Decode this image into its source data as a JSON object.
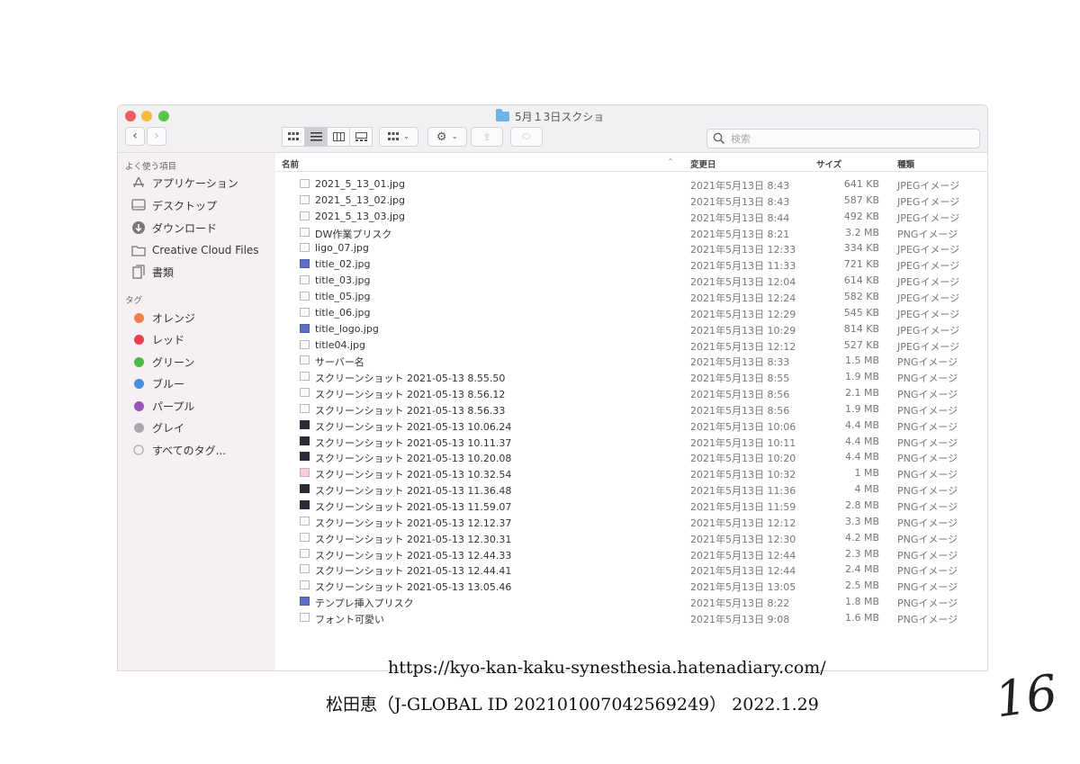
{
  "window": {
    "title": "5月１3日スクショ",
    "search_placeholder": "検索"
  },
  "sidebar": {
    "favorites_heading": "よく使う項目",
    "favorites": [
      {
        "label": "アプリケーション",
        "icon": "applications-icon"
      },
      {
        "label": "デスクトップ",
        "icon": "desktop-icon"
      },
      {
        "label": "ダウンロード",
        "icon": "download-icon"
      },
      {
        "label": "Creative Cloud Files",
        "icon": "folder-icon"
      },
      {
        "label": "書類",
        "icon": "documents-icon"
      }
    ],
    "tags_heading": "タグ",
    "tags": [
      {
        "label": "オレンジ",
        "color": "#f07f4e"
      },
      {
        "label": "レッド",
        "color": "#e8404f"
      },
      {
        "label": "グリーン",
        "color": "#4cb848"
      },
      {
        "label": "ブルー",
        "color": "#4a8ee0"
      },
      {
        "label": "パープル",
        "color": "#9a55b4"
      },
      {
        "label": "グレイ",
        "color": "#a8a8b0"
      }
    ],
    "all_tags": "すべてのタグ..."
  },
  "columns": {
    "name": "名前",
    "modified": "変更日",
    "size": "サイズ",
    "kind": "種類"
  },
  "files": [
    {
      "name": "2021_5_13_01.jpg",
      "date": "2021年5月13日 8:43",
      "size": "641 KB",
      "kind": "JPEGイメージ",
      "icon": "image"
    },
    {
      "name": "2021_5_13_02.jpg",
      "date": "2021年5月13日 8:43",
      "size": "587 KB",
      "kind": "JPEGイメージ",
      "icon": "image"
    },
    {
      "name": "2021_5_13_03.jpg",
      "date": "2021年5月13日 8:44",
      "size": "492 KB",
      "kind": "JPEGイメージ",
      "icon": "image"
    },
    {
      "name": "DW作業プリスク",
      "date": "2021年5月13日 8:21",
      "size": "3.2 MB",
      "kind": "PNGイメージ",
      "icon": "image"
    },
    {
      "name": "ligo_07.jpg",
      "date": "2021年5月13日 12:33",
      "size": "334 KB",
      "kind": "JPEGイメージ",
      "icon": "image"
    },
    {
      "name": "title_02.jpg",
      "date": "2021年5月13日 11:33",
      "size": "721 KB",
      "kind": "JPEGイメージ",
      "icon": "blue"
    },
    {
      "name": "title_03.jpg",
      "date": "2021年5月13日 12:04",
      "size": "614 KB",
      "kind": "JPEGイメージ",
      "icon": "image"
    },
    {
      "name": "title_05.jpg",
      "date": "2021年5月13日 12:24",
      "size": "582 KB",
      "kind": "JPEGイメージ",
      "icon": "image"
    },
    {
      "name": "title_06.jpg",
      "date": "2021年5月13日 12:29",
      "size": "545 KB",
      "kind": "JPEGイメージ",
      "icon": "image"
    },
    {
      "name": "title_logo.jpg",
      "date": "2021年5月13日 10:29",
      "size": "814 KB",
      "kind": "JPEGイメージ",
      "icon": "blue"
    },
    {
      "name": "title04.jpg",
      "date": "2021年5月13日 12:12",
      "size": "527 KB",
      "kind": "JPEGイメージ",
      "icon": "image"
    },
    {
      "name": "サーバー名",
      "date": "2021年5月13日 8:33",
      "size": "1.5 MB",
      "kind": "PNGイメージ",
      "icon": "image"
    },
    {
      "name": "スクリーンショット 2021-05-13 8.55.50",
      "date": "2021年5月13日 8:55",
      "size": "1.9 MB",
      "kind": "PNGイメージ",
      "icon": "image"
    },
    {
      "name": "スクリーンショット 2021-05-13 8.56.12",
      "date": "2021年5月13日 8:56",
      "size": "2.1 MB",
      "kind": "PNGイメージ",
      "icon": "image"
    },
    {
      "name": "スクリーンショット 2021-05-13 8.56.33",
      "date": "2021年5月13日 8:56",
      "size": "1.9 MB",
      "kind": "PNGイメージ",
      "icon": "image"
    },
    {
      "name": "スクリーンショット 2021-05-13 10.06.24",
      "date": "2021年5月13日 10:06",
      "size": "4.4 MB",
      "kind": "PNGイメージ",
      "icon": "dark"
    },
    {
      "name": "スクリーンショット 2021-05-13 10.11.37",
      "date": "2021年5月13日 10:11",
      "size": "4.4 MB",
      "kind": "PNGイメージ",
      "icon": "dark"
    },
    {
      "name": "スクリーンショット 2021-05-13 10.20.08",
      "date": "2021年5月13日 10:20",
      "size": "4.4 MB",
      "kind": "PNGイメージ",
      "icon": "dark"
    },
    {
      "name": "スクリーンショット 2021-05-13 10.32.54",
      "date": "2021年5月13日 10:32",
      "size": "1 MB",
      "kind": "PNGイメージ",
      "icon": "pink"
    },
    {
      "name": "スクリーンショット 2021-05-13 11.36.48",
      "date": "2021年5月13日 11:36",
      "size": "4 MB",
      "kind": "PNGイメージ",
      "icon": "dark"
    },
    {
      "name": "スクリーンショット 2021-05-13 11.59.07",
      "date": "2021年5月13日 11:59",
      "size": "2.8 MB",
      "kind": "PNGイメージ",
      "icon": "dark"
    },
    {
      "name": "スクリーンショット 2021-05-13 12.12.37",
      "date": "2021年5月13日 12:12",
      "size": "3.3 MB",
      "kind": "PNGイメージ",
      "icon": "image"
    },
    {
      "name": "スクリーンショット 2021-05-13 12.30.31",
      "date": "2021年5月13日 12:30",
      "size": "4.2 MB",
      "kind": "PNGイメージ",
      "icon": "image"
    },
    {
      "name": "スクリーンショット 2021-05-13 12.44.33",
      "date": "2021年5月13日 12:44",
      "size": "2.3 MB",
      "kind": "PNGイメージ",
      "icon": "image"
    },
    {
      "name": "スクリーンショット 2021-05-13 12.44.41",
      "date": "2021年5月13日 12:44",
      "size": "2.4 MB",
      "kind": "PNGイメージ",
      "icon": "image"
    },
    {
      "name": "スクリーンショット 2021-05-13 13.05.46",
      "date": "2021年5月13日 13:05",
      "size": "2.5 MB",
      "kind": "PNGイメージ",
      "icon": "image"
    },
    {
      "name": "テンプレ挿入プリスク",
      "date": "2021年5月13日 8:22",
      "size": "1.8 MB",
      "kind": "PNGイメージ",
      "icon": "blue"
    },
    {
      "name": "フォント可愛い",
      "date": "2021年5月13日 9:08",
      "size": "1.6 MB",
      "kind": "PNGイメージ",
      "icon": "image"
    }
  ],
  "footer": {
    "url": "https://kyo-kan-kaku-synesthesia.hatenadiary.com/",
    "citation": "松田恵（J-GLOBAL ID 202101007042569249） 2022.1.29",
    "page_number": "16"
  }
}
